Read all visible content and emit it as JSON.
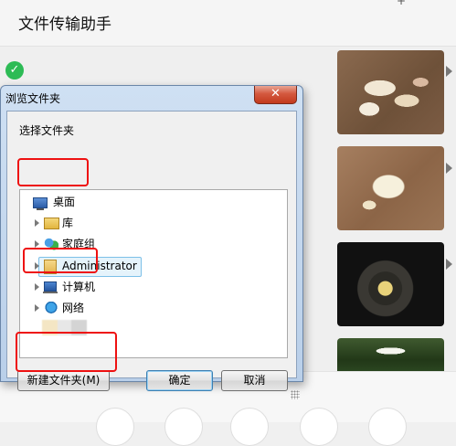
{
  "chat": {
    "title": "文件传输助手",
    "status": "sent"
  },
  "dialog": {
    "title": "浏览文件夹",
    "close": "✕",
    "prompt": "选择文件夹",
    "tree": [
      {
        "label": "桌面",
        "icon": "desktop-icon",
        "expandable": false
      },
      {
        "label": "库",
        "icon": "library-icon",
        "expandable": true
      },
      {
        "label": "家庭组",
        "icon": "homegroup-icon",
        "expandable": true
      },
      {
        "label": "Administrator",
        "icon": "user-folder-icon",
        "expandable": true,
        "selected": true
      },
      {
        "label": "计算机",
        "icon": "computer-icon",
        "expandable": true
      },
      {
        "label": "网络",
        "icon": "network-icon",
        "expandable": true
      }
    ],
    "buttons": {
      "new_folder": "新建文件夹(M)",
      "ok": "确定",
      "cancel": "取消"
    }
  },
  "colors": {
    "highlight": "#e11111",
    "close": "#c2391d",
    "sent_check": "#2dbb55"
  }
}
